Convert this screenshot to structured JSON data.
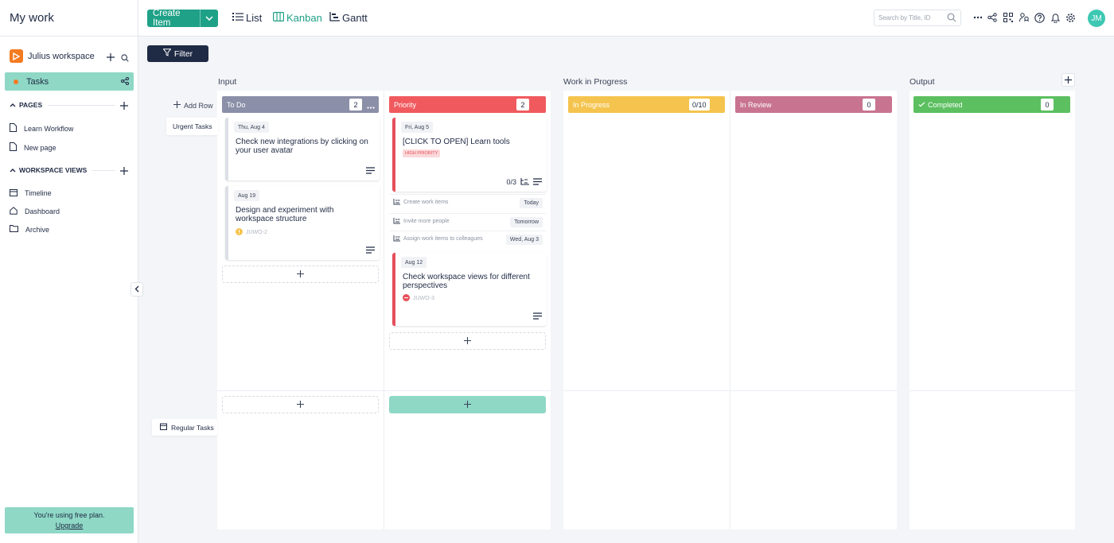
{
  "header": {
    "title": "My work",
    "create_label": "Create Item",
    "views": [
      {
        "label": "List",
        "icon": "list-icon"
      },
      {
        "label": "Kanban",
        "icon": "kanban-icon"
      },
      {
        "label": "Gantt",
        "icon": "gantt-icon"
      }
    ],
    "active_view": "Kanban",
    "search_placeholder": "Search by Title, ID",
    "avatar_initials": "JM",
    "icons": [
      "more-icon",
      "share-icon",
      "qr-icon",
      "people-icon",
      "help-icon",
      "bell-icon",
      "gear-icon"
    ]
  },
  "sidebar": {
    "workspace_name": "Julius workspace",
    "active_item": "Tasks",
    "pages_header": "PAGES",
    "pages": [
      "Learn Workflow",
      "New page"
    ],
    "views_header": "WORKSPACE VIEWS",
    "views": [
      {
        "label": "Timeline",
        "icon": "calendar-icon"
      },
      {
        "label": "Dashboard",
        "icon": "home-icon"
      },
      {
        "label": "Archive",
        "icon": "folder-icon"
      }
    ],
    "plan_text": "You're using free plan.",
    "upgrade_label": "Upgrade"
  },
  "board": {
    "filter_label": "Filter",
    "add_row_label": "Add Row",
    "rows": [
      "Urgent Tasks",
      "Regular Tasks"
    ],
    "groups": [
      "Input",
      "Work in Progress",
      "Output"
    ],
    "columns": [
      {
        "name": "To Do",
        "count": "2",
        "color": "#8c8fa8"
      },
      {
        "name": "Priority",
        "count": "2",
        "color": "#f05a5e"
      },
      {
        "name": "In Progress",
        "count": "0/10",
        "color": "#f5c44e"
      },
      {
        "name": "In Review",
        "count": "0",
        "color": "#c87490"
      },
      {
        "name": "Completed",
        "count": "0",
        "color": "#5cbf60"
      }
    ],
    "cards": {
      "todo1": {
        "date": "Thu, Aug 4",
        "title": "Check new integrations by clicking on your  user avatar"
      },
      "todo2": {
        "date": "Aug 19",
        "title": "Design and experiment with workspace structure",
        "id": "JUWO-2"
      },
      "pri1": {
        "date": "Fri, Aug 5",
        "title": "[CLICK TO OPEN] Learn tools",
        "badge": "HIGH PRIORITY",
        "progress": "0/3"
      },
      "pri2": {
        "date": "Aug 12",
        "title": "Check workspace views for different perspectives",
        "id": "JUWO-3"
      }
    },
    "subitems": [
      {
        "label": "Create work items",
        "due": "Today"
      },
      {
        "label": "Invite more people",
        "due": "Tomorrow"
      },
      {
        "label": "Assign work items to colleagues",
        "due": "Wed, Aug 3"
      }
    ]
  }
}
